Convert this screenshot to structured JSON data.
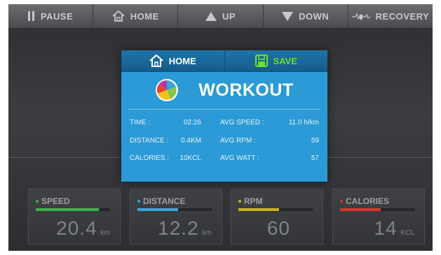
{
  "topbar": {
    "items": [
      {
        "label": "PAUSE",
        "icon": "pause-icon"
      },
      {
        "label": "HOME",
        "icon": "home-icon"
      },
      {
        "label": "UP",
        "icon": "up-arrow-icon"
      },
      {
        "label": "DOWN",
        "icon": "down-arrow-icon"
      },
      {
        "label": "RECOVERY",
        "icon": "heart-pulse-icon"
      }
    ]
  },
  "dialog": {
    "home_label": "HOME",
    "save_label": "SAVE",
    "title": "WORKOUT",
    "stats": [
      {
        "label": "TIME :",
        "value": "02:26",
        "label2": "AVG SPEED :",
        "value2": "11.0 h/km"
      },
      {
        "label": "DISTANCE :",
        "value": "0.4KM",
        "label2": "AVG RPM :",
        "value2": "59"
      },
      {
        "label": "CALORIES :",
        "value": "10KCL",
        "label2": "AVG WATT :",
        "value2": "57"
      }
    ]
  },
  "cards": [
    {
      "title": "SPEED",
      "value": "20.4",
      "unit": "km",
      "color": "#3fb24a",
      "level": 0.85
    },
    {
      "title": "DISTANCE",
      "value": "12.2",
      "unit": "km",
      "color": "#3aa6d8",
      "level": 0.55
    },
    {
      "title": "RPM",
      "value": "60",
      "unit": "",
      "color": "#c9b21e",
      "level": 0.55
    },
    {
      "title": "CALORIES",
      "value": "14",
      "unit": "KCL",
      "color": "#d9352b",
      "level": 0.55
    }
  ],
  "colors": {
    "dialog_bg": "#2b9ad6",
    "save_green": "#6ee02a",
    "topbar_text": "#c8c9cb"
  }
}
